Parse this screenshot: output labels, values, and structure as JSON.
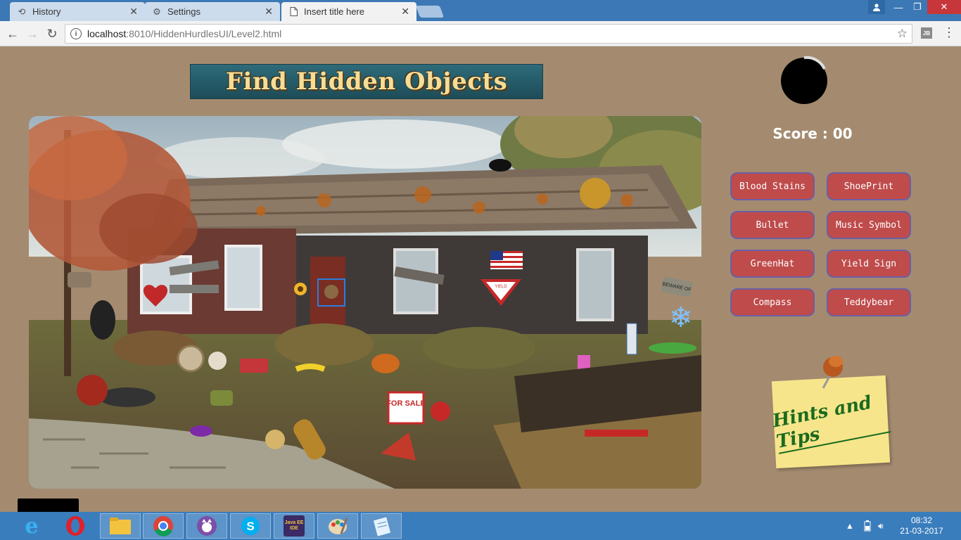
{
  "browser": {
    "tabs": [
      {
        "title": "History",
        "icon": "history-icon"
      },
      {
        "title": "Settings",
        "icon": "gear-icon"
      },
      {
        "title": "Insert title here",
        "icon": "page-icon",
        "active": true
      }
    ],
    "close_glyph": "✕",
    "address": {
      "host": "localhost",
      "path": ":8010/HiddenHurdlesUI/Level2.html"
    },
    "extension_label": "JB"
  },
  "page": {
    "banner_title": "Find Hidden Objects",
    "score_label": "Score : 00",
    "objects": [
      "Blood Stains",
      "ShoePrint",
      "Bullet",
      "Music Symbol",
      "GreenHat",
      "Yield Sign",
      "Compass",
      "Teddybear"
    ],
    "hints_label": "Hints and Tips",
    "scene": {
      "yield_text": "YIELD",
      "for_sale_text": "FOR SALE",
      "beware_sign": "BEWARE OF"
    }
  },
  "taskbar": {
    "apps": [
      "internet-explorer-icon",
      "opera-icon",
      "file-explorer-icon",
      "chrome-icon",
      "cat-app-icon",
      "skype-icon",
      "java-ee-ide-icon",
      "paint-icon",
      "notepad-icon"
    ],
    "java_label": "Java EE IDE",
    "time": "08:32",
    "date": "21-03-2017"
  },
  "colors": {
    "page_bg": "#a48b70",
    "button_bg": "#bf4b4b",
    "button_border": "#6a5fa4",
    "taskbar": "#3a7dbd"
  }
}
